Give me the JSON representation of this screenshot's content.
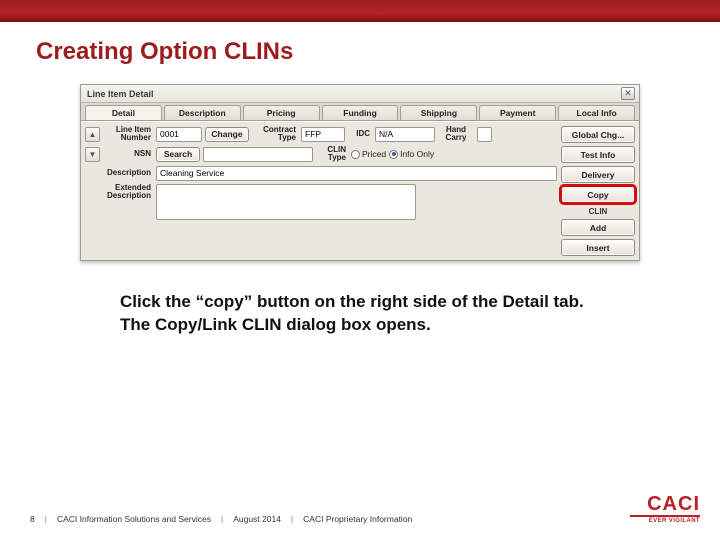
{
  "slide": {
    "title": "Creating Option CLINs",
    "instruction": "Click the “copy” button on the right side of the Detail tab.  The Copy/Link CLIN dialog box opens."
  },
  "app": {
    "window_title": "Line Item Detail",
    "close_glyph": "✕",
    "tabs": [
      "Detail",
      "Description",
      "Pricing",
      "Funding",
      "Shipping",
      "Payment",
      "Local Info"
    ],
    "labels": {
      "line_item": "Line Item Number",
      "contract_type": "Contract Type",
      "idc": "IDC",
      "hand_carry": "Hand Carry",
      "nsn": "NSN",
      "clin_type": "CLIN Type",
      "priced": "Priced",
      "info_only": "Info Only",
      "description": "Description",
      "extended_description": "Extended Description"
    },
    "fields": {
      "line_item_value": "0001",
      "change_btn": "Change",
      "contract_type_value": "FFP",
      "idc_value": "N/A",
      "search_btn": "Search",
      "description_value": "Cleaning Service",
      "clin_type_selected": "info_only"
    },
    "side_buttons": {
      "global_chg": "Global Chg...",
      "test_info": "Test Info",
      "delivery": "Delivery",
      "copy": "Copy",
      "clin_section": "CLIN",
      "add": "Add",
      "insert": "Insert"
    }
  },
  "footer": {
    "page": "8",
    "org": "CACI Information Solutions and Services",
    "date": "August 2014",
    "classification": "CACI Proprietary Information",
    "sep": "|",
    "logo_main": "CACI",
    "logo_tag": "EVER VIGILANT"
  }
}
